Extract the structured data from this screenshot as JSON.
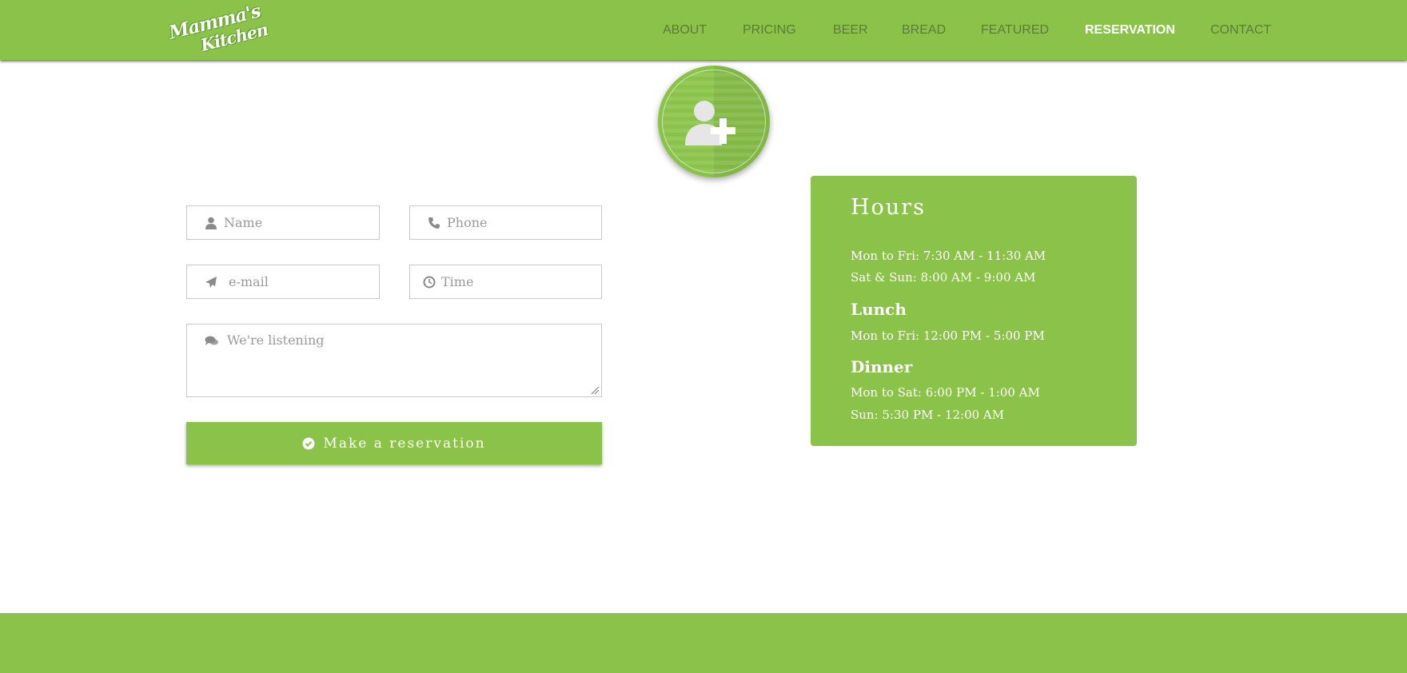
{
  "brand": {
    "logo_line1": "Mamma's",
    "logo_line2": "Kitchen"
  },
  "nav": {
    "about": "ABOUT",
    "pricing": "PRICING",
    "beer": "BEER",
    "bread": "BREAD",
    "featured": "FEATURED",
    "reservation": "RESERVATION",
    "contact": "CONTACT",
    "active": "RESERVATION"
  },
  "form": {
    "name_placeholder": "Name",
    "phone_placeholder": "Phone",
    "email_placeholder": "e-mail",
    "time_placeholder": "Time",
    "message_placeholder": "We're listening",
    "submit_label": "Make a reservation"
  },
  "hours": {
    "title": "Hours",
    "breakfast_line1": "Mon to Fri: 7:30 AM - 11:30 AM",
    "breakfast_line2": "Sat & Sun: 8:00 AM - 9:00 AM",
    "lunch_title": "Lunch",
    "lunch_line1": "Mon to Fri: 12:00 PM - 5:00 PM",
    "dinner_title": "Dinner",
    "dinner_line1": "Mon to Sat: 6:00 PM - 1:00 AM",
    "dinner_line2": "Sun: 5:30 PM - 12:00 AM"
  },
  "icons": {
    "name": "user-icon",
    "phone": "phone-icon",
    "email": "paper-plane-icon",
    "time": "clock-icon",
    "message": "comments-icon",
    "submit": "check-circle-icon",
    "badge": "add-user-icon"
  },
  "colors": {
    "brand_green": "#8bc34a",
    "nav_text": "#5d7a3a",
    "nav_active": "#ffffff"
  }
}
